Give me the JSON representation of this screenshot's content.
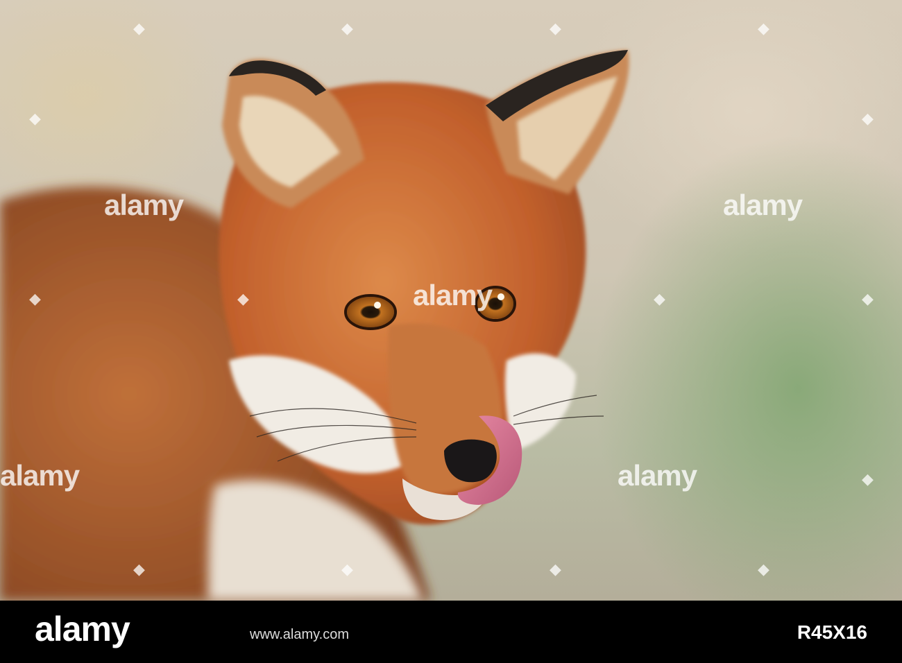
{
  "photo": {
    "subject": "red-fox-licking-nose",
    "watermark_text": "alamy",
    "watermark_mark": "◆",
    "colors": {
      "fur": "#c8602a",
      "fur_light": "#e0935a",
      "white_fur": "#f1ece4",
      "ear_black": "#2a2420",
      "tongue": "#d9728c",
      "nose": "#1a1718",
      "eye": "#b86a1a"
    }
  },
  "footer": {
    "logo": "alamy",
    "image_id": "R45X16",
    "url": "www.alamy.com"
  }
}
